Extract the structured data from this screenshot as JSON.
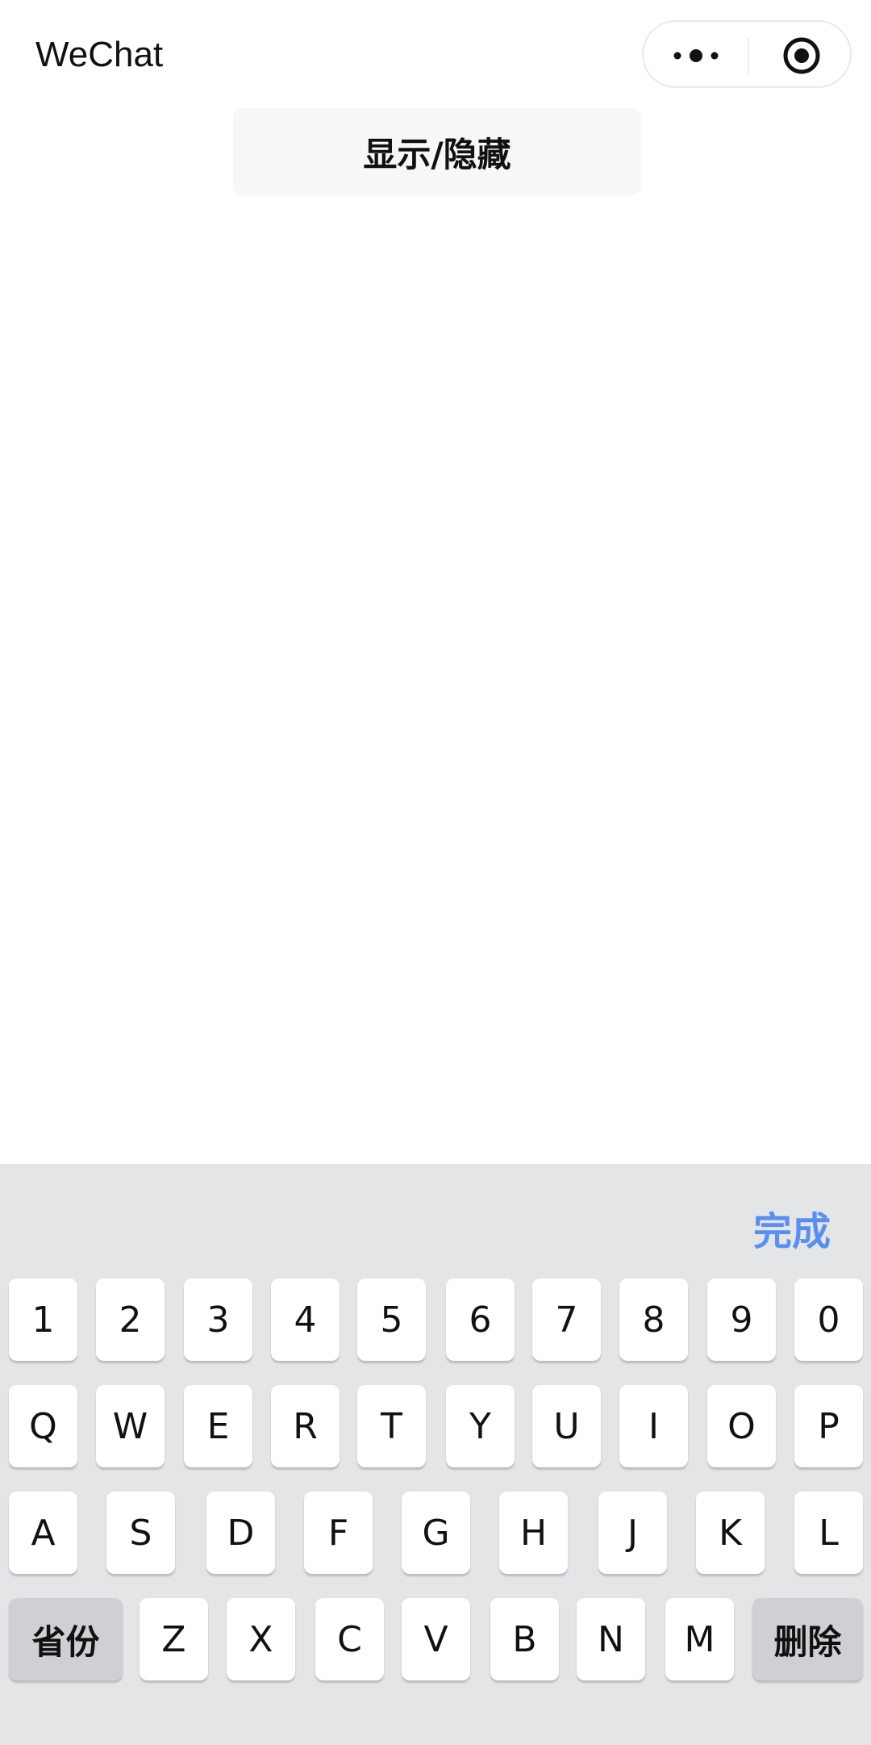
{
  "header": {
    "title": "WeChat",
    "more_icon": "more-dots-icon",
    "target_icon": "target-circle-icon"
  },
  "main": {
    "toggle_label": "显示/隐藏"
  },
  "keyboard": {
    "done_label": "完成",
    "done_color": "#5a8ff0",
    "row1": [
      "1",
      "2",
      "3",
      "4",
      "5",
      "6",
      "7",
      "8",
      "9",
      "0"
    ],
    "row2": [
      "Q",
      "W",
      "E",
      "R",
      "T",
      "Y",
      "U",
      "I",
      "O",
      "P"
    ],
    "row3": [
      "A",
      "S",
      "D",
      "F",
      "G",
      "H",
      "J",
      "K",
      "L"
    ],
    "row4": [
      "Z",
      "X",
      "C",
      "V",
      "B",
      "N",
      "M"
    ],
    "province_label": "省份",
    "delete_label": "删除"
  }
}
